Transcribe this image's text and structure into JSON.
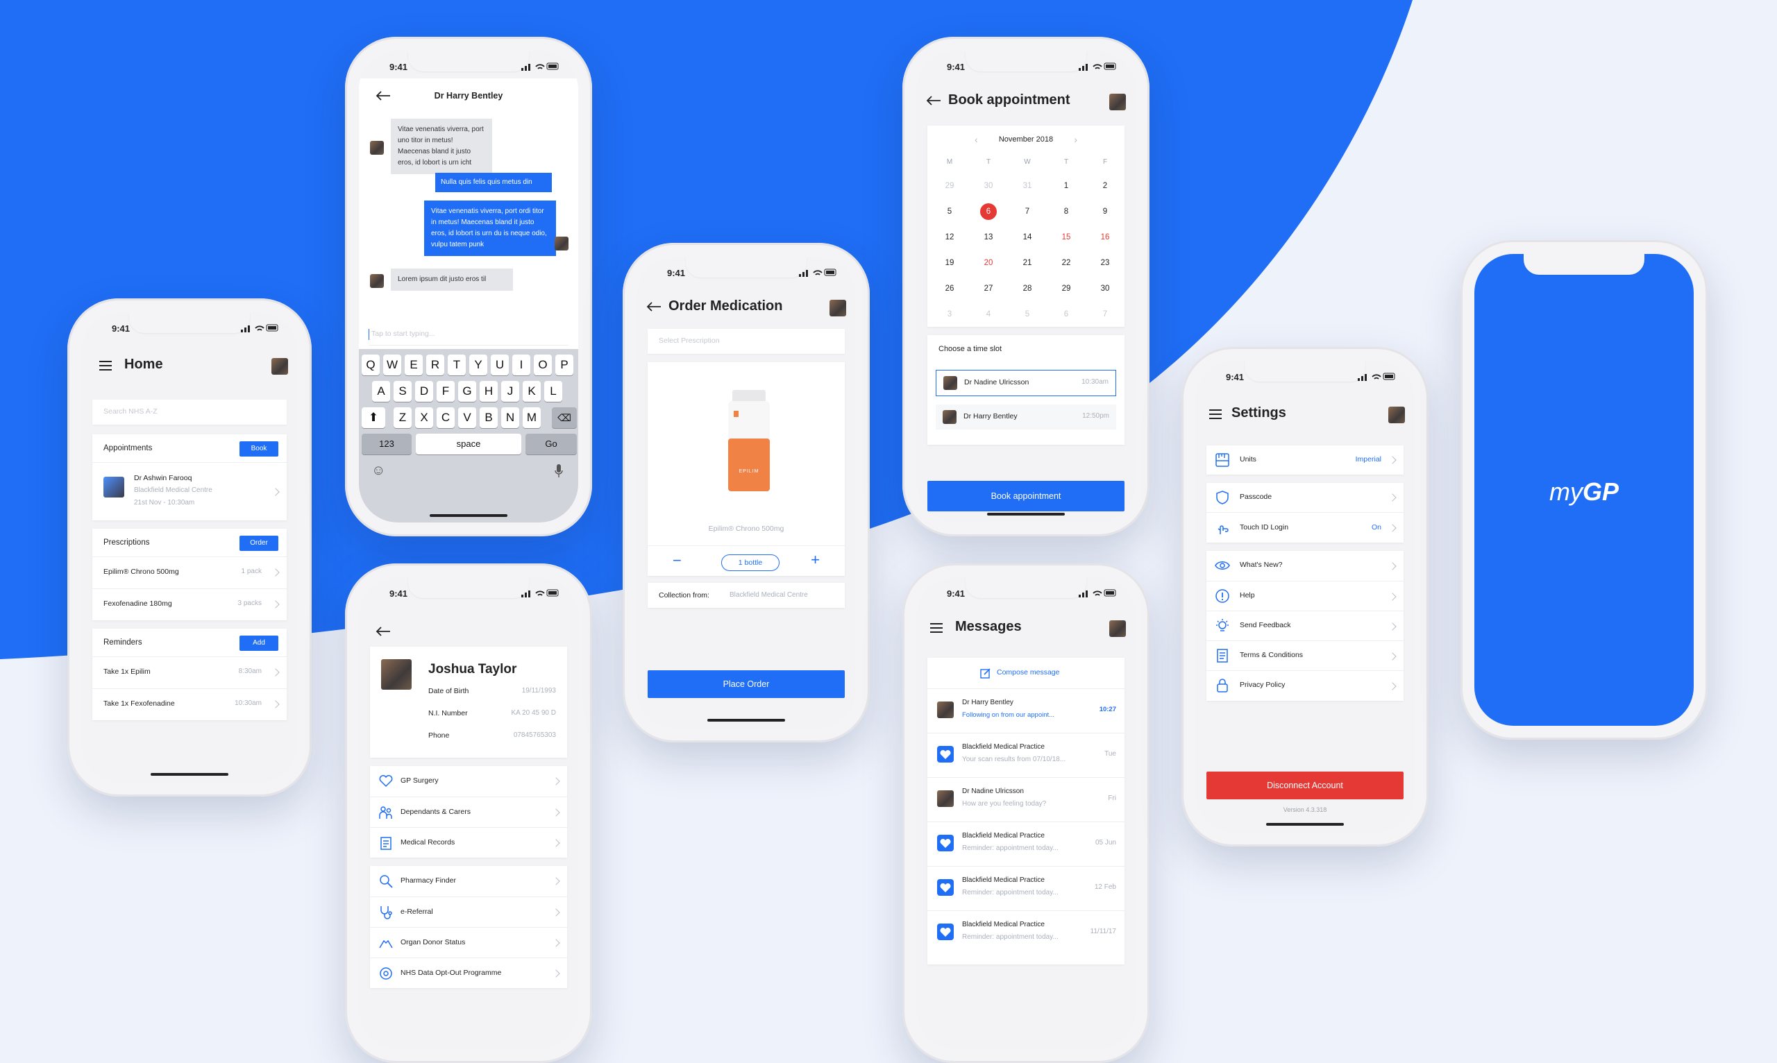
{
  "colors": {
    "brand": "#1f6ef5",
    "danger": "#e53935",
    "background": "#eef2fb"
  },
  "status_time": "9:41",
  "home": {
    "title": "Home",
    "search_placeholder": "Search NHS A-Z",
    "appointments": {
      "title": "Appointments",
      "action": "Book",
      "doctor": "Dr Ashwin Farooq",
      "place": "Blackfield Medical Centre",
      "when": "21st Nov - 10:30am"
    },
    "prescriptions": {
      "title": "Prescriptions",
      "action": "Order",
      "items": [
        {
          "name": "Epilim® Chrono 500mg",
          "qty": "1 pack"
        },
        {
          "name": "Fexofenadine 180mg",
          "qty": "3 packs"
        }
      ]
    },
    "reminders": {
      "title": "Reminders",
      "action": "Add",
      "items": [
        {
          "name": "Take 1x Epilim",
          "time": "8:30am"
        },
        {
          "name": "Take 1x Fexofenadine",
          "time": "10:30am"
        }
      ]
    }
  },
  "chat": {
    "title": "Dr Harry Bentley",
    "messages": [
      {
        "dir": "in",
        "text": "Vitae venenatis viverra, port uno titor in metus! Maecenas bland it justo eros, id lobort is urn icht"
      },
      {
        "dir": "out",
        "text": "Nulla quis felis quis metus din"
      },
      {
        "dir": "out",
        "text": "Vitae venenatis viverra, port ordi titor in metus! Maecenas bland it justo eros, id lobort is urn du is neque odio, vulpu tatem punk"
      },
      {
        "dir": "in",
        "text": "Lorem ipsum dit justo eros til"
      }
    ],
    "input_placeholder": "Tap to start typing...",
    "keyboard": {
      "row1": [
        "Q",
        "W",
        "E",
        "R",
        "T",
        "Y",
        "U",
        "I",
        "O",
        "P"
      ],
      "row2": [
        "A",
        "S",
        "D",
        "F",
        "G",
        "H",
        "J",
        "K",
        "L"
      ],
      "row3": [
        "Z",
        "X",
        "C",
        "V",
        "B",
        "N",
        "M"
      ],
      "numbers": "123",
      "space": "space",
      "go": "Go"
    }
  },
  "profile": {
    "name": "Joshua Taylor",
    "fields": [
      {
        "label": "Date of Birth",
        "value": "19/11/1993"
      },
      {
        "label": "N.I. Number",
        "value": "KA 20 45 90 D"
      },
      {
        "label": "Phone",
        "value": "07845765303"
      }
    ],
    "group1": [
      {
        "label": "GP Surgery",
        "icon": "heart-icon"
      },
      {
        "label": "Dependants & Carers",
        "icon": "family-icon"
      },
      {
        "label": "Medical Records",
        "icon": "clipboard-icon"
      }
    ],
    "group2": [
      {
        "label": "Pharmacy Finder",
        "icon": "search-icon"
      },
      {
        "label": "e-Referral",
        "icon": "stethoscope-icon"
      },
      {
        "label": "Organ Donor Status",
        "icon": "hands-icon"
      },
      {
        "label": "NHS Data Opt-Out Programme",
        "icon": "data-icon"
      }
    ]
  },
  "order": {
    "title": "Order Medication",
    "select_placeholder": "Select Prescription",
    "bottle_label": "EPILIM",
    "product": "Epilim® Chrono 500mg",
    "quantity": "1 bottle",
    "collection_label": "Collection from:",
    "collection_place": "Blackfield Medical Centre",
    "cta": "Place Order"
  },
  "book": {
    "title": "Book appointment",
    "month": "November 2018",
    "weekdays": [
      "M",
      "T",
      "W",
      "T",
      "F"
    ],
    "weeks": [
      [
        "29",
        "30",
        "31",
        "1",
        "2"
      ],
      [
        "5",
        "6",
        "7",
        "8",
        "9"
      ],
      [
        "12",
        "13",
        "14",
        "15",
        "16"
      ],
      [
        "19",
        "20",
        "21",
        "22",
        "23"
      ],
      [
        "26",
        "27",
        "28",
        "29",
        "30"
      ],
      [
        "3",
        "4",
        "5",
        "6",
        "7"
      ]
    ],
    "selected_day": "6",
    "slot_title": "Choose a time slot",
    "slots": [
      {
        "doctor": "Dr Nadine Ulricsson",
        "time": "10:30am"
      },
      {
        "doctor": "Dr Harry Bentley",
        "time": "12:50pm"
      }
    ],
    "cta": "Book appointment"
  },
  "messages": {
    "title": "Messages",
    "compose": "Compose message",
    "items": [
      {
        "from": "Dr Harry Bentley",
        "preview": "Following on from our appoint...",
        "time": "10:27",
        "unread": true,
        "icon": "doctor-avatar"
      },
      {
        "from": "Blackfield Medical Practice",
        "preview": "Your scan results from 07/10/18...",
        "time": "Tue",
        "unread": false,
        "icon": "heart-icon"
      },
      {
        "from": "Dr Nadine Ulricsson",
        "preview": "How are you feeling today?",
        "time": "Fri",
        "unread": false,
        "icon": "doctor-avatar"
      },
      {
        "from": "Blackfield Medical Practice",
        "preview": "Reminder: appointment today...",
        "time": "05 Jun",
        "unread": false,
        "icon": "heart-icon"
      },
      {
        "from": "Blackfield Medical Practice",
        "preview": "Reminder: appointment today...",
        "time": "12 Feb",
        "unread": false,
        "icon": "heart-icon"
      },
      {
        "from": "Blackfield Medical Practice",
        "preview": "Reminder: appointment today...",
        "time": "11/11/17",
        "unread": false,
        "icon": "heart-icon"
      }
    ]
  },
  "settings": {
    "title": "Settings",
    "group1": [
      {
        "label": "Units",
        "value": "Imperial",
        "icon": "ruler-icon"
      }
    ],
    "group2": [
      {
        "label": "Passcode",
        "value": "",
        "icon": "shield-icon"
      },
      {
        "label": "Touch ID Login",
        "value": "On",
        "icon": "fingerprint-icon"
      }
    ],
    "group3": [
      {
        "label": "What's New?",
        "value": "",
        "icon": "eye-icon"
      },
      {
        "label": "Help",
        "value": "",
        "icon": "help-icon"
      },
      {
        "label": "Send Feedback",
        "value": "",
        "icon": "bulb-icon"
      },
      {
        "label": "Terms & Conditions",
        "value": "",
        "icon": "document-icon"
      },
      {
        "label": "Privacy Policy",
        "value": "",
        "icon": "lock-icon"
      }
    ],
    "cta": "Disconnect Account",
    "version": "Version 4.3.318"
  },
  "splash": {
    "logo_my": "my",
    "logo_gp": "GP"
  }
}
